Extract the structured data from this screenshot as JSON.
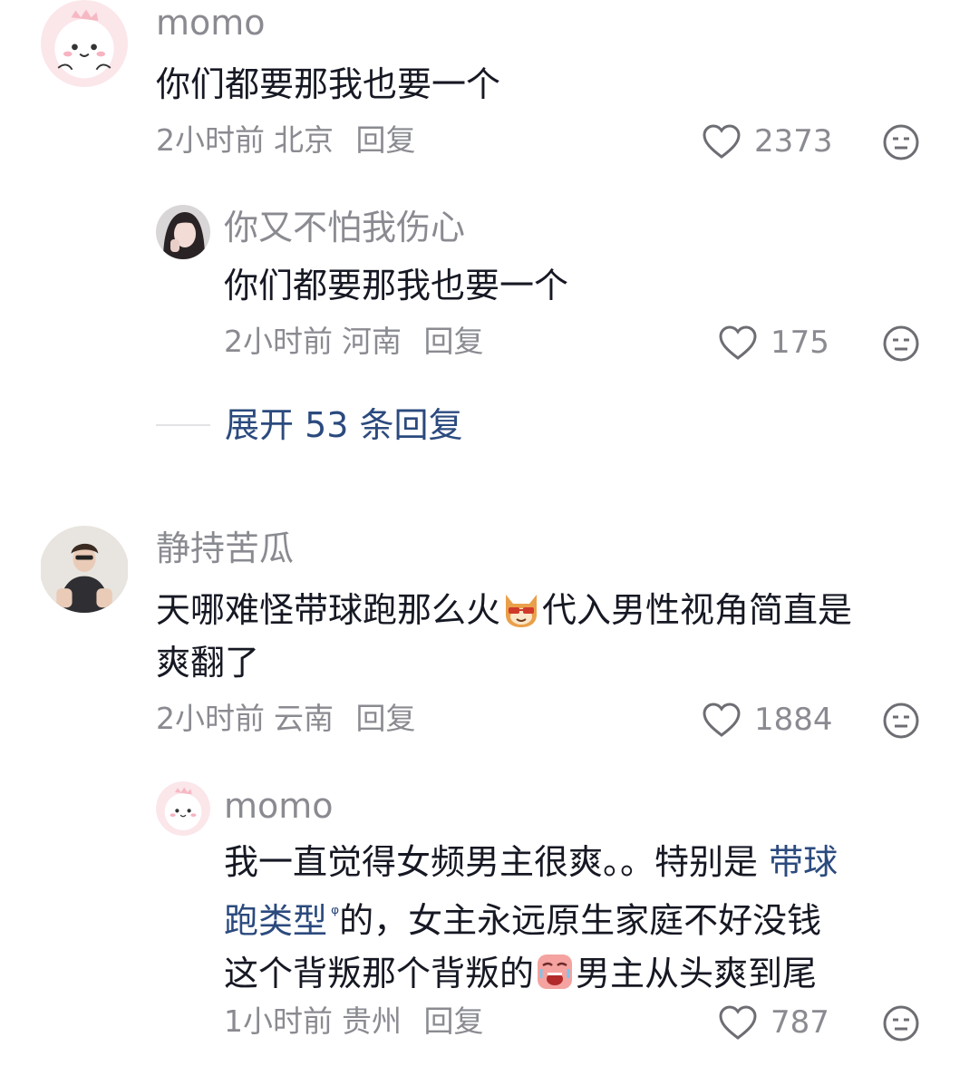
{
  "comments": [
    {
      "username": "momo",
      "text": "你们都要那我也要一个",
      "time": "2小时前",
      "location": "北京",
      "reply": "回复",
      "likes": "2373",
      "avatar": "pink-dinosaur-avatar"
    },
    {
      "username": "你又不怕我伤心",
      "text": "你们都要那我也要一个",
      "time": "2小时前",
      "location": "河南",
      "reply": "回复",
      "likes": "175",
      "avatar": "girl-photo-avatar"
    },
    {
      "username": "静持苦瓜",
      "text_line1a": "天哪难怪带球跑那么火",
      "text_line1b": "代入男性视角简直是",
      "text_line2": "爽翻了",
      "emoji": "shiba-cool-emoji",
      "time": "2小时前",
      "location": "云南",
      "reply": "回复",
      "likes": "1884",
      "avatar": "man-photo-avatar"
    },
    {
      "username": "momo",
      "text_line1a": "我一直觉得女频男主很爽。。特别是 ",
      "text_link_a": "带球",
      "text_link_b": "跑类型",
      "text_line2": "的，女主永远原生家庭不好没钱",
      "text_line3a": "这个背叛那个背叛的",
      "text_line3b": "男主从头爽到尾",
      "emoji": "crying-face-emoji",
      "search_mark": "ᵠ",
      "time": "1小时前",
      "location": "贵州",
      "reply": "回复",
      "likes": "787",
      "avatar": "pink-dinosaur-avatar"
    }
  ],
  "expand_replies": "展开 53 条回复",
  "colors": {
    "text": "#161823",
    "muted": "#8a8b91",
    "link": "#2b4a7e"
  }
}
